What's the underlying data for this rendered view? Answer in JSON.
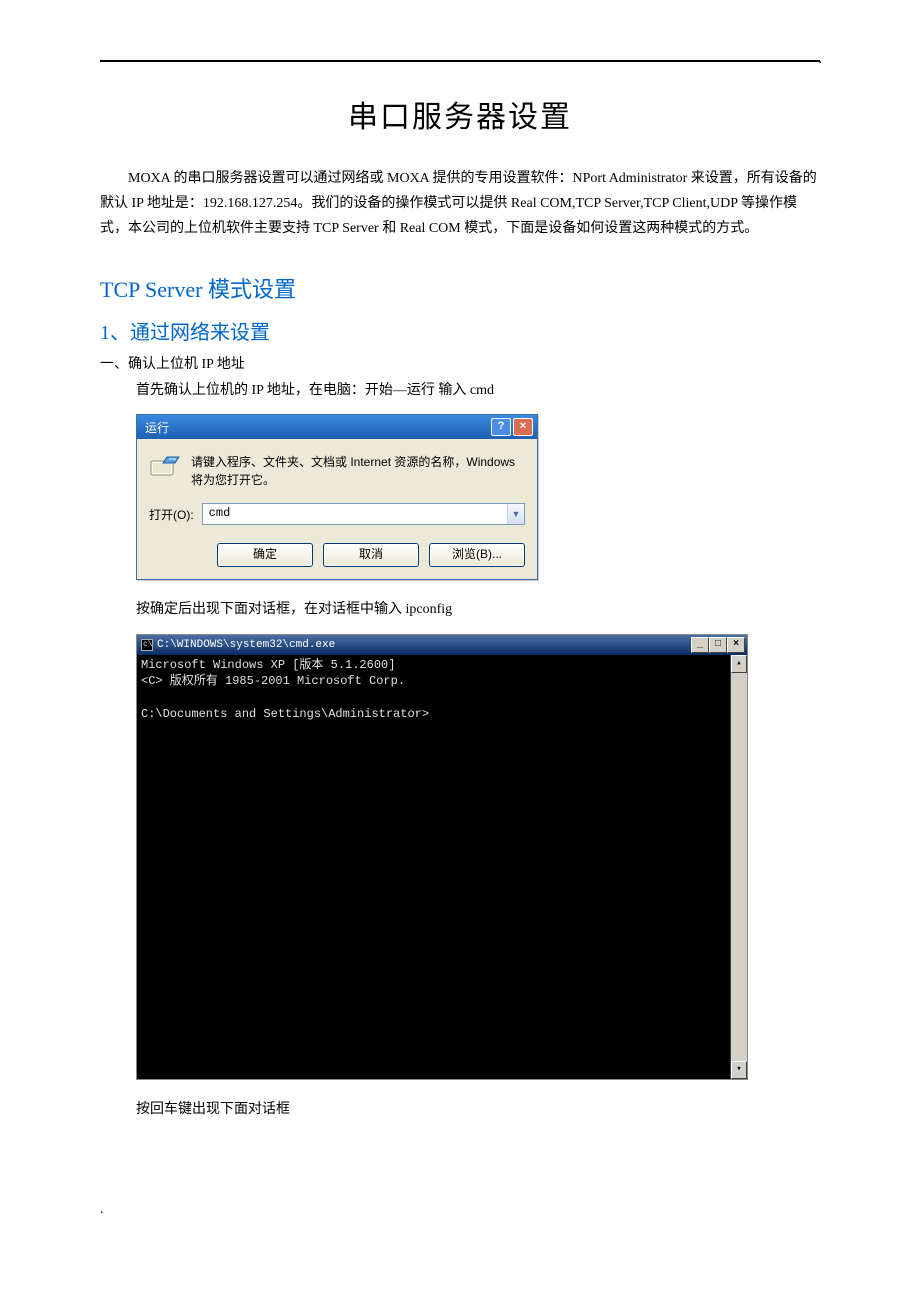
{
  "doc": {
    "title": "串口服务器设置",
    "intro": "MOXA 的串口服务器设置可以通过网络或 MOXA 提供的专用设置软件：NPort Administrator 来设置，所有设备的默认 IP 地址是：192.168.127.254。我们的设备的操作模式可以提供 Real COM,TCP Server,TCP Client,UDP 等操作模式，本公司的上位机软件主要支持 TCP Server  和 Real COM 模式，下面是设备如何设置这两种模式的方式。",
    "h2a": "TCP Server  模式设置",
    "h2b": "1、通过网络来设置",
    "sec1": "一、确认上位机 IP 地址",
    "sec1_line": "首先确认上位机的 IP 地址，在电脑：开始—运行  输入 cmd",
    "after_run": "按确定后出现下面对话框，在对话框中输入 ipconfig",
    "after_cmd": "按回车键出现下面对话框"
  },
  "run_dialog": {
    "title": "运行",
    "desc": "请键入程序、文件夹、文档或 Internet 资源的名称，Windows 将为您打开它。",
    "open_label": "打开(O):",
    "input_value": "cmd",
    "btn_ok": "确定",
    "btn_cancel": "取消",
    "btn_browse": "浏览(B)..."
  },
  "cmd": {
    "title": "C:\\WINDOWS\\system32\\cmd.exe",
    "line1": "Microsoft Windows XP [版本 5.1.2600]",
    "line2": "<C> 版权所有 1985-2001 Microsoft Corp.",
    "prompt": "C:\\Documents and Settings\\Administrator>"
  }
}
